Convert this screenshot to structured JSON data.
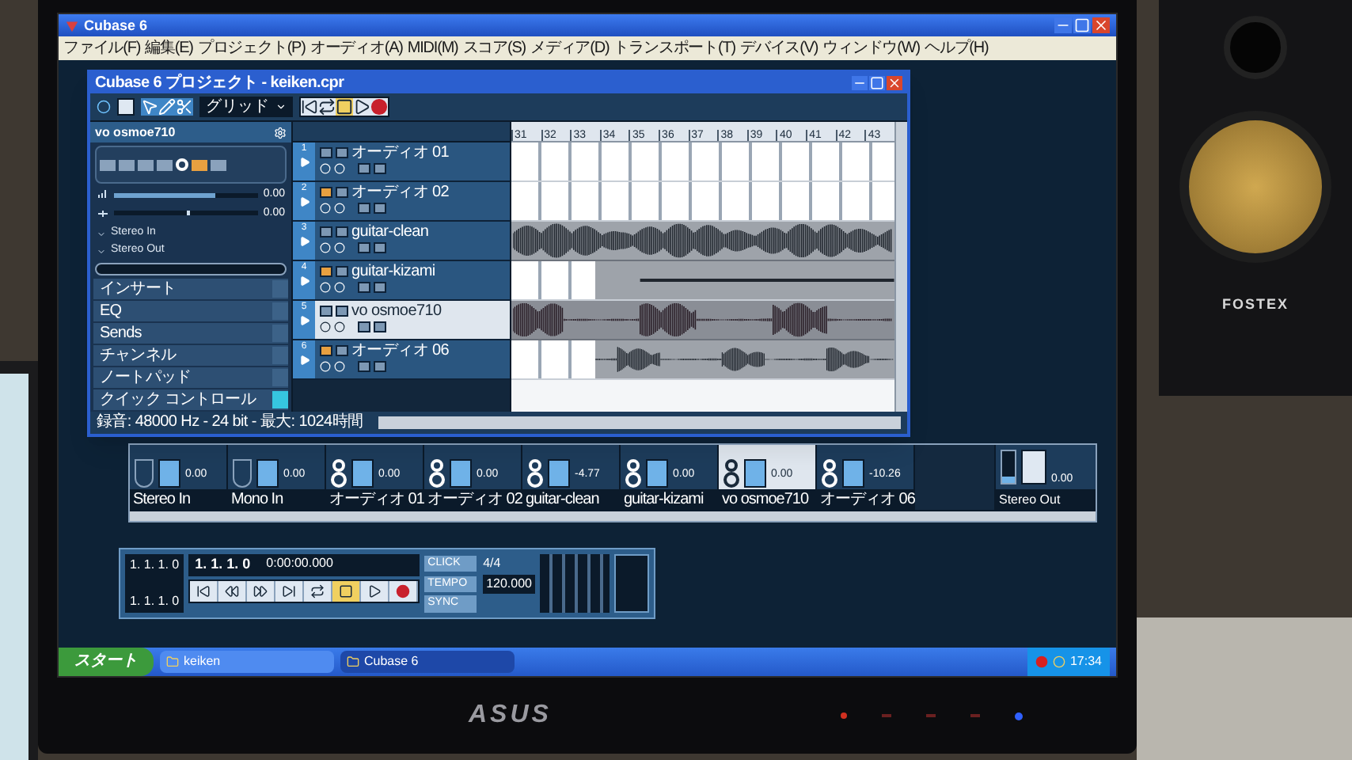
{
  "cubase": {
    "title": "Cubase 6",
    "menu": [
      "ファイル(F)",
      "編集(E)",
      "プロジェクト(P)",
      "オーディオ(A)",
      "MIDI(M)",
      "スコア(S)",
      "メディア(D)",
      "トランスポート(T)",
      "デバイス(V)",
      "ウィンドウ(W)",
      "ヘルプ(H)"
    ]
  },
  "project": {
    "title": "Cubase 6 プロジェクト - keiken.cpr",
    "snap": "グリッド",
    "inspector": {
      "track": "vo osmoe710",
      "volume": "0.00",
      "volume_level": {
        "level": 0.7
      },
      "pan": "0.00",
      "pan_position": {
        "level": 0.5
      },
      "routing": [
        "Stereo In",
        "Stereo Out"
      ],
      "sections": [
        {
          "label": "インサート",
          "on": false
        },
        {
          "label": "EQ",
          "on": false
        },
        {
          "label": "Sends",
          "on": false
        },
        {
          "label": "チャンネル",
          "on": false
        },
        {
          "label": "ノートパッド",
          "on": false
        },
        {
          "label": "クイック コントロール",
          "on": true
        }
      ]
    },
    "ruler": [
      "31",
      "32",
      "33",
      "34",
      "35",
      "36",
      "37",
      "38",
      "39",
      "40",
      "41",
      "42",
      "43"
    ],
    "tracks": [
      {
        "number": "1",
        "name": "オーディオ 01",
        "record_ready": false,
        "selected": false,
        "kind": "empty"
      },
      {
        "number": "2",
        "name": "オーディオ 02",
        "record_ready": true,
        "selected": false,
        "kind": "empty"
      },
      {
        "number": "3",
        "name": "guitar-clean",
        "record_ready": false,
        "selected": false,
        "kind": "waveform"
      },
      {
        "number": "4",
        "name": "guitar-kizami",
        "record_ready": true,
        "selected": false,
        "kind": "flat"
      },
      {
        "number": "5",
        "name": "vo osmoe710",
        "record_ready": false,
        "selected": true,
        "kind": "waveform"
      },
      {
        "number": "6",
        "name": "オーディオ 06",
        "record_ready": true,
        "selected": false,
        "kind": "late_waveform"
      }
    ],
    "status": "録音: 48000 Hz - 24 bit - 最大: 1024時間"
  },
  "mixer": {
    "channels": [
      {
        "kind": "input",
        "name": "Stereo In",
        "reading": "0.00",
        "selected": false
      },
      {
        "kind": "input",
        "name": "Mono In",
        "reading": "0.00",
        "selected": false
      },
      {
        "kind": "audio",
        "name": "オーディオ 01",
        "reading": "0.00",
        "selected": false
      },
      {
        "kind": "audio",
        "name": "オーディオ 02",
        "reading": "0.00",
        "selected": false
      },
      {
        "kind": "audio",
        "name": "guitar-clean",
        "reading": "-4.77",
        "selected": false
      },
      {
        "kind": "audio",
        "name": "guitar-kizami",
        "reading": "0.00",
        "selected": false
      },
      {
        "kind": "audio",
        "name": "vo osmoe710",
        "reading": "0.00",
        "selected": true
      },
      {
        "kind": "audio",
        "name": "オーディオ 06",
        "reading": "-10.26",
        "selected": false
      },
      {
        "kind": "output",
        "name": "Stereo Out",
        "reading": "0.00",
        "selected": false
      }
    ]
  },
  "transport": {
    "left_locator": "1. 1. 1. 0",
    "right_locator": "1. 1. 1. 0",
    "position": "1. 1. 1. 0",
    "time": "0:00:00.000",
    "buttons": [
      {
        "kind": "start",
        "selected": false
      },
      {
        "kind": "rewind",
        "selected": false
      },
      {
        "kind": "forward",
        "selected": false
      },
      {
        "kind": "end",
        "selected": false
      },
      {
        "kind": "cycle",
        "selected": false
      },
      {
        "kind": "stop",
        "selected": true
      },
      {
        "kind": "play",
        "selected": false
      },
      {
        "kind": "record",
        "selected": false
      }
    ],
    "click": "CLICK",
    "tempo_label": "TEMPO",
    "sync": "SYNC",
    "signature": "4/4",
    "tempo": "120.000"
  },
  "taskbar": {
    "start": "スタート",
    "tasks": [
      {
        "label": "keiken",
        "selected": false
      },
      {
        "label": "Cubase 6",
        "selected": true
      }
    ],
    "clock": "17:34"
  },
  "monitor": {
    "brand": "ASUS"
  },
  "speaker": {
    "brand": "FOSTEX"
  }
}
